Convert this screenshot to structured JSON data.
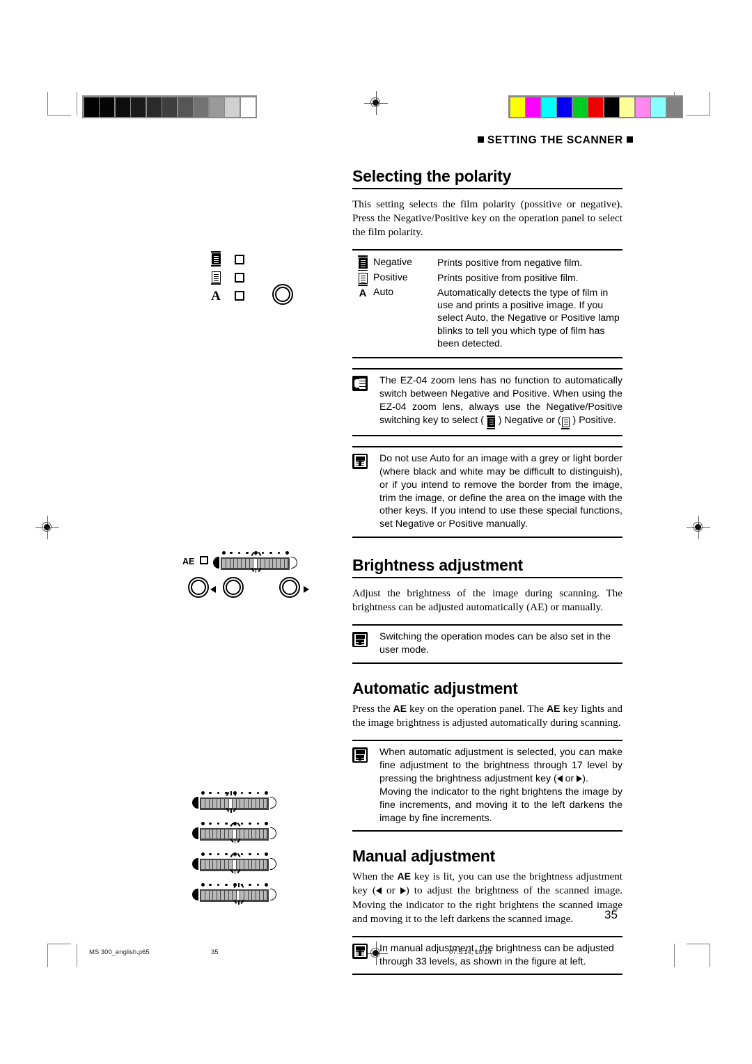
{
  "document": {
    "running_head": "SETTING THE SCANNER",
    "page_number": "35"
  },
  "sections": [
    {
      "id": "selecting-the-polarity",
      "heading": "Selecting the polarity",
      "body": "This setting selects the film polarity (possitive or negative). Press the Negative/Positive key on the operation panel to select the film polarity."
    },
    {
      "id": "brightness-adjustment",
      "heading": "Brightness adjustment",
      "body": "Adjust the brightness of the image during scanning. The brightness can be adjusted automatically (AE) or manually."
    },
    {
      "id": "automatic-adjustment",
      "heading": "Automatic adjustment",
      "body_part1": "Press the ",
      "body_key1": "AE",
      "body_part2": " key on the operation panel. The ",
      "body_key2": "AE",
      "body_part3": " key lights and the image brightness is adjusted automatically during scanning."
    },
    {
      "id": "manual-adjustment",
      "heading": "Manual adjustment",
      "body_part1": "When the ",
      "body_key1": "AE",
      "body_part2": " key is lit, you can use the brightness adjustment key (",
      "body_part3": " or ",
      "body_part4": ") to adjust the brightness of the scanned image. Moving the indicator to the right brightens the scanned image and moving it to the left darkens the scanned image."
    }
  ],
  "polarity_table": {
    "rows": [
      {
        "glyph": "negative-film-icon",
        "name": "Negative",
        "description": "Prints positive from negative film."
      },
      {
        "glyph": "positive-film-icon",
        "name": "Positive",
        "description": "Prints positive from positive film."
      },
      {
        "glyph": "A",
        "name": "Auto",
        "description": "Automatically detects the type of film in use and prints a positive image. If you select Auto, the Negative or Positive lamp blinks to tell you which type of film has been detected."
      }
    ]
  },
  "notes": [
    {
      "id": "note-ez04-lens",
      "icon": "hand-note-icon",
      "text_part1": "The EZ-04 zoom lens has no function to automatically switch between Negative and Positive. When using the EZ-04 zoom lens, always use the Negative/Positive switching key to select ( ",
      "text_part2": " ) Negative or (",
      "text_part3": " ) Positive."
    },
    {
      "id": "note-auto-grey-border",
      "icon": "memo-note-icon",
      "text": "Do not use Auto for an image with a grey or light border (where black and white may be difficult to distinguish), or if you intend to remove the border from the image, trim the image, or define the area on the image with the other keys. If you intend to use these special functions, set Negative or Positive manually."
    },
    {
      "id": "note-user-mode",
      "icon": "memo-note-icon",
      "text": "Switching the operation modes can be also set in the user mode."
    },
    {
      "id": "note-17-levels",
      "icon": "memo-note-icon",
      "text_part1": "When automatic adjustment is selected, you can make fine adjustment to the brightness through 17 level by pressing the brightness adjustment key (",
      "text_part2": " or ",
      "text_part3": ").",
      "text_part4": "Moving the indicator to the right brightens the image by fine increments, and moving it to the left darkens the image by fine increments."
    },
    {
      "id": "note-33-levels",
      "icon": "memo-note-icon",
      "text": "In manual adjustment, the brightness can be adjusted through 33 levels, as shown in the figure at left."
    }
  ],
  "figures": {
    "polarity_panel": {
      "rows": [
        {
          "glyph": "negative-film-icon",
          "led": "square-led"
        },
        {
          "glyph": "positive-film-icon",
          "led": "square-led"
        },
        {
          "glyph": "A",
          "led": "square-led"
        }
      ],
      "button": "negative-positive-key"
    },
    "ae_panel": {
      "label": "AE",
      "led": "square-led",
      "segments": 17,
      "active_index": 8,
      "dots": 9,
      "buttons": [
        "ae-key",
        "brightness-left-key",
        "brightness-right-key"
      ]
    },
    "manual_bars": [
      {
        "segments": 17,
        "active_index": 7,
        "dots": 9
      },
      {
        "segments": 17,
        "active_index": 8,
        "dots": 9
      },
      {
        "segments": 17,
        "active_index": 8,
        "dots": 9
      },
      {
        "segments": 17,
        "active_index": 9,
        "dots": 9
      }
    ]
  },
  "calibration": {
    "grayscale": [
      "#000000",
      "#050505",
      "#0d0d0d",
      "#1a1a1a",
      "#2b2b2b",
      "#3f3f3f",
      "#565656",
      "#737373",
      "#9a9a9a",
      "#d0d0d0",
      "#ffffff"
    ],
    "colorbar": [
      "#ffff00",
      "#ff00ff",
      "#00ffff",
      "#0000ee",
      "#00cc22",
      "#ee0000",
      "#000000",
      "#ffff99",
      "#ff88ee",
      "#88ffff",
      "#808080"
    ]
  },
  "footer": {
    "filename": "MS 300_english.p65",
    "page": "35",
    "timestamp": "07.5.14, 10:14"
  }
}
